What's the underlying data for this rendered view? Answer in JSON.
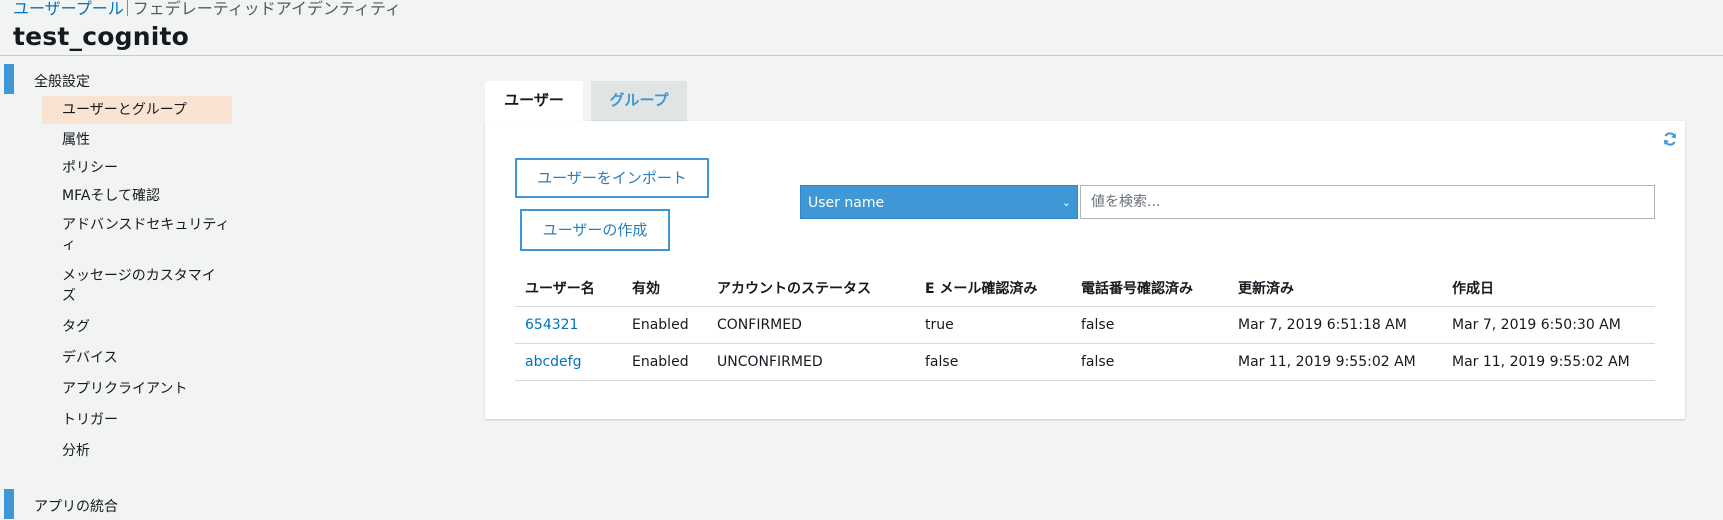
{
  "breadcrumb": {
    "user_pool": "ユーザープール",
    "federated_identity": "フェデレーティッドアイデンティティ"
  },
  "page_title": "test_cognito",
  "sidebar": {
    "general_settings": "全般設定",
    "items": [
      {
        "label": "ユーザーとグループ",
        "active": true
      },
      {
        "label": "属性"
      },
      {
        "label": "ポリシー"
      },
      {
        "label": "MFAそして確認"
      },
      {
        "label": "アドバンスドセキュリティ\nィ"
      },
      {
        "label": "メッセージのカスタマイ\nズ"
      },
      {
        "label": "タグ"
      },
      {
        "label": "デバイス"
      },
      {
        "label": "アプリクライアント"
      },
      {
        "label": "トリガー"
      },
      {
        "label": "分析"
      }
    ],
    "app_integration": "アプリの統合"
  },
  "tabs": {
    "users": "ユーザー",
    "groups": "グループ"
  },
  "buttons": {
    "import_users": "ユーザーをインポート",
    "create_user": "ユーザーの作成"
  },
  "filter": {
    "selected": "User name",
    "search_placeholder": "値を検索..."
  },
  "table": {
    "columns": [
      "ユーザー名",
      "有効",
      "アカウントのステータス",
      "E メール確認済み",
      "電話番号確認済み",
      "更新済み",
      "作成日"
    ],
    "rows": [
      [
        "654321",
        "Enabled",
        "CONFIRMED",
        "true",
        "false",
        "Mar 7, 2019 6:51:18 AM",
        "Mar 7, 2019 6:50:30 AM"
      ],
      [
        "abcdefg",
        "Enabled",
        "UNCONFIRMED",
        "false",
        "false",
        "Mar 11, 2019 9:55:02 AM",
        "Mar 11, 2019 9:55:02 AM"
      ]
    ]
  },
  "icons": {
    "refresh": "refresh-icon",
    "dropdown": "chevron-down-icon"
  },
  "colors": {
    "accent": "#3f97d5",
    "link": "#0073bb",
    "active_nav": "#f9e4d3"
  }
}
